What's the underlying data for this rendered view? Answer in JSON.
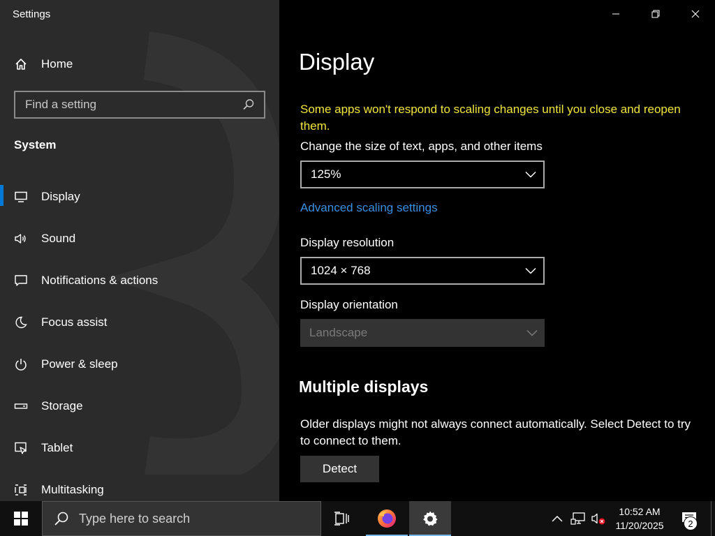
{
  "window": {
    "title": "Settings"
  },
  "sidebar": {
    "home_label": "Home",
    "search_placeholder": "Find a setting",
    "section_title": "System",
    "items": [
      {
        "label": "Display",
        "icon": "monitor-icon",
        "active": true
      },
      {
        "label": "Sound",
        "icon": "speaker-icon"
      },
      {
        "label": "Notifications & actions",
        "icon": "notification-icon"
      },
      {
        "label": "Focus assist",
        "icon": "moon-icon"
      },
      {
        "label": "Power & sleep",
        "icon": "power-icon"
      },
      {
        "label": "Storage",
        "icon": "storage-icon"
      },
      {
        "label": "Tablet",
        "icon": "tablet-icon"
      },
      {
        "label": "Multitasking",
        "icon": "multitasking-icon"
      }
    ]
  },
  "main": {
    "title": "Display",
    "warning": "Some apps won't respond to scaling changes until you close and reopen them.",
    "scale_label": "Change the size of text, apps, and other items",
    "scale_value": "125%",
    "advanced_link": "Advanced scaling settings",
    "resolution_label": "Display resolution",
    "resolution_value": "1024 × 768",
    "orientation_label": "Display orientation",
    "orientation_value": "Landscape",
    "multiple_title": "Multiple displays",
    "multiple_desc": "Older displays might not always connect automatically. Select Detect to try to connect to them.",
    "detect_button": "Detect"
  },
  "taskbar": {
    "search_placeholder": "Type here to search",
    "time": "10:52 AM",
    "date": "11/20/2025",
    "notification_count": "2"
  },
  "colors": {
    "accent": "#0078d7",
    "warning": "#f0e63c",
    "link": "#3a8fe0"
  }
}
